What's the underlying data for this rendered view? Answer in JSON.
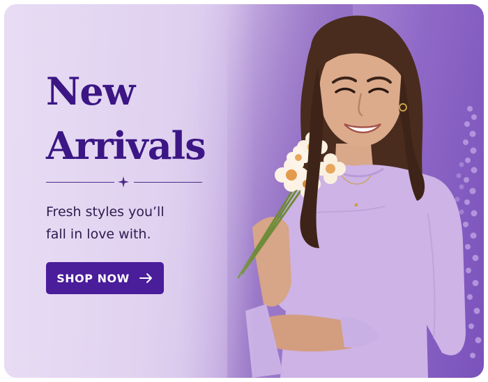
{
  "promo": {
    "headline_line1": "New",
    "headline_line2": "Arrivals",
    "subtitle_line1": "Fresh styles you’ll",
    "subtitle_line2": "fall in love with.",
    "cta_label": "SHOP NOW",
    "cta_icon": "arrow-right-icon",
    "divider_icon": "sparkle-icon"
  },
  "colors": {
    "accent": "#4a1d9a",
    "headline": "#3b1684",
    "background_light": "#e5d7f1",
    "background_dark": "#7a52bb"
  }
}
